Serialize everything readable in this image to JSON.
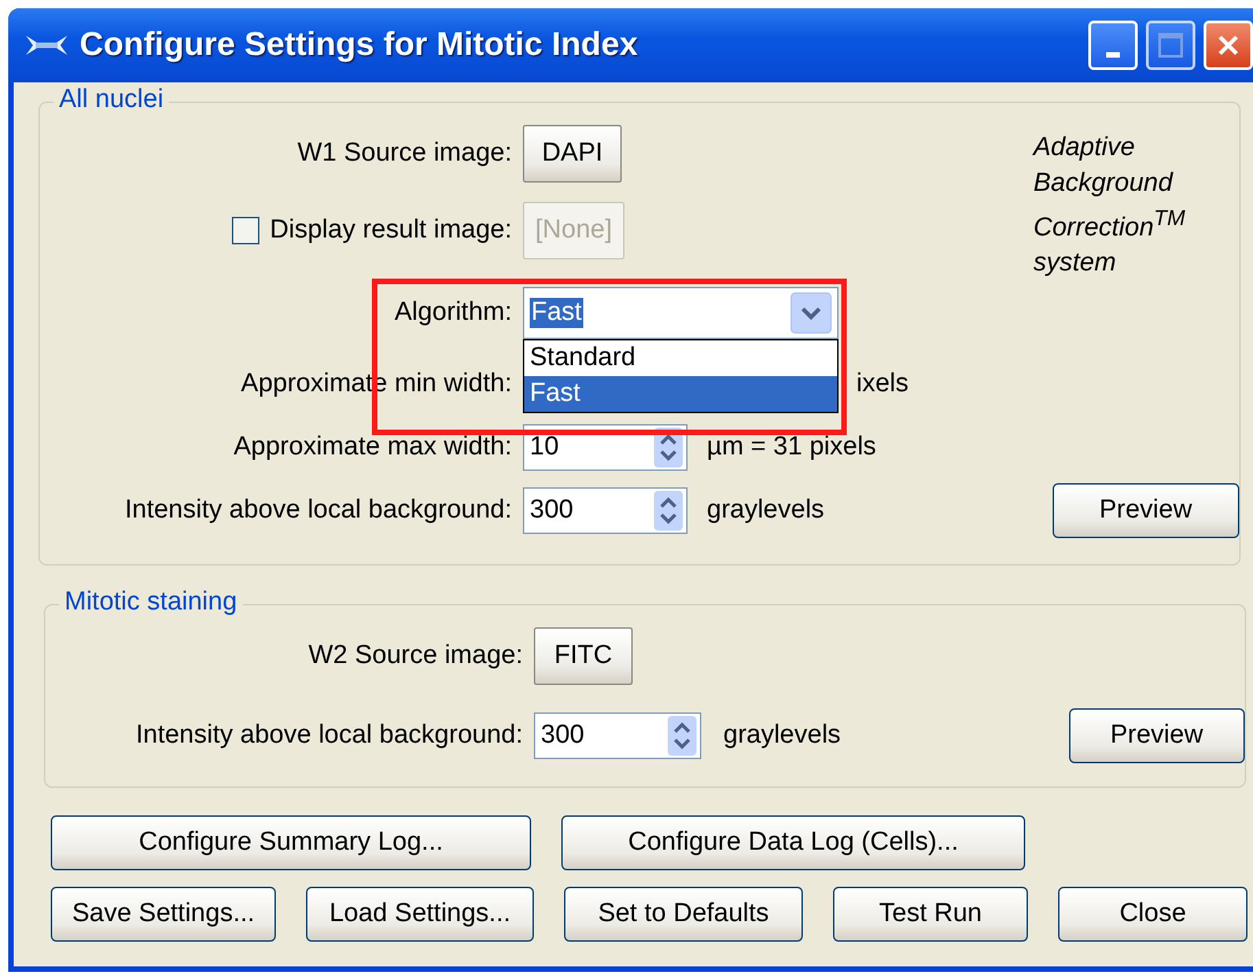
{
  "window": {
    "title": "Configure Settings for Mitotic Index"
  },
  "all_nuclei": {
    "title": "All nuclei",
    "w1_source": {
      "label": "W1 Source image:",
      "button": "DAPI"
    },
    "display_result": {
      "label": "Display result image:",
      "checked": false,
      "button": "[None]",
      "button_disabled": true
    },
    "algorithm": {
      "label": "Algorithm:",
      "value": "Fast",
      "expanded": true,
      "highlighted": true,
      "options": [
        {
          "label": "Standard",
          "selected": false
        },
        {
          "label": "Fast",
          "selected": true
        }
      ]
    },
    "min_width": {
      "label": "Approximate min width:",
      "unit": "ixels"
    },
    "max_width": {
      "label": "Approximate max width:",
      "value": "10",
      "unit": "µm = 31 pixels"
    },
    "intensity": {
      "label": "Intensity above local background:",
      "value": "300",
      "unit": "graylevels",
      "button": "Preview"
    },
    "note": "Adaptive Background Correction$^{TM}$ system"
  },
  "mitotic_staining": {
    "title": "Mitotic staining",
    "w2_source": {
      "label": "W2 Source image:",
      "button": "FITC"
    },
    "intensity": {
      "label": "Intensity above local background:",
      "value": "300",
      "unit": "graylevels",
      "button": "Preview"
    }
  },
  "buttons": [
    [
      "Configure Summary Log...",
      "Configure Data Log (Cells)..."
    ],
    [
      "Save Settings...",
      "Load Settings...",
      "Set to Defaults",
      "Test Run",
      "Close"
    ]
  ]
}
